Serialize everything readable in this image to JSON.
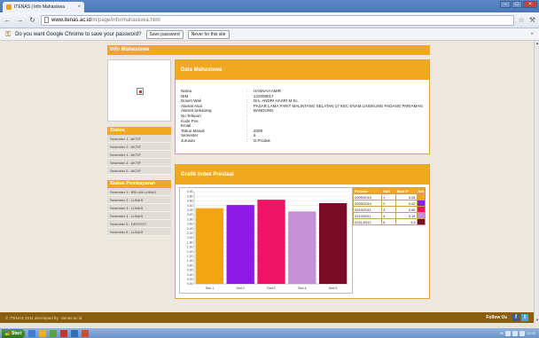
{
  "browser": {
    "tab_title": "ITENAS | Info Mahasiswa",
    "url_host": "www.itenas.ac.id",
    "url_path": "/m/page/informahasiswa.html",
    "infobar": {
      "message": "Do you want Google Chrome to save your password?",
      "save_label": "Save password",
      "never_label": "Never for this site"
    }
  },
  "page": {
    "title": "Info Mahasiswa",
    "status": {
      "heading": "Status",
      "items": [
        "Semester 1 : AKTIF",
        "Semester 2 : AKTIF",
        "Semester 3 : AKTIF",
        "Semester 4 : AKTIF",
        "Semester 5 : AKTIF"
      ]
    },
    "payment": {
      "heading": "Status Pembayaran",
      "items": [
        "Semester 1 : BELUM LUNAS",
        "Semester 2 : LUNAS",
        "Semester 3 : LUNAS",
        "Semester 4 : LUNAS",
        "Semester 5 : DEPOSIT",
        "Semester 6 : LUNAS"
      ]
    },
    "data_panel": {
      "heading": "Data Mahasiswa",
      "rows": [
        {
          "label": "Nama",
          "value": "HASNAH AMIR"
        },
        {
          "label": "NIM",
          "value": "122009017"
        },
        {
          "label": "Dosen Wali",
          "value": "Drs. ANDRI HASRI M.Sc."
        },
        {
          "label": "Alamat Asal",
          "value": "PASAR LAMA PARIT MALINTANG SELATAN 17 KEC ENAM LINGKUNG PADANG PARIAMAN 25584"
        },
        {
          "label": "Alamat Sekarang",
          "value": "BANDUNG"
        },
        {
          "label": "No.Telepon",
          "value": ""
        },
        {
          "label": "Kode Pos.",
          "value": ""
        },
        {
          "label": "Email",
          "value": ""
        },
        {
          "label": "Tahun Masuk",
          "value": "2009"
        },
        {
          "label": "Semester",
          "value": "6"
        },
        {
          "label": "Jurusan",
          "value": "D.Produk"
        }
      ]
    },
    "chart_panel": {
      "heading": "Grafik Indek Prestasi",
      "legend_headers": [
        "Periode",
        "Smt",
        "Nilai IP",
        "Ket"
      ]
    },
    "footer": {
      "copyright": "© ITENAS 2011 developed by : itenas.ac.id",
      "follow": "Follow Us"
    }
  },
  "taskbar": {
    "start_label": "Start",
    "lang": "IN",
    "clock": "12:40"
  },
  "colors": {
    "accent": "#f0a820",
    "footer": "#8a5e10"
  },
  "chart_data": {
    "type": "bar",
    "title": "",
    "categories": [
      "Smt 1",
      "Smt 2",
      "Smt 3",
      "Smt 4",
      "Smt 5"
    ],
    "values": [
      3.28,
      3.42,
      3.65,
      3.14,
      3.5
    ],
    "periods": [
      "2009/2010",
      "2009/2010",
      "2010/2011",
      "2010/2011",
      "2011/2012"
    ],
    "semesters": [
      "1",
      "2",
      "3",
      "4",
      "5"
    ],
    "colors": [
      "#f2a50c",
      "#8e1ae6",
      "#ef1466",
      "#c690d8",
      "#7a0c28"
    ],
    "ylim": [
      0,
      4
    ],
    "yticks": [
      "0.00",
      "0.20",
      "0.40",
      "0.60",
      "0.80",
      "1.00",
      "1.20",
      "1.40",
      "1.60",
      "1.80",
      "2.00",
      "2.20",
      "2.40",
      "2.60",
      "2.80",
      "3.00",
      "3.20",
      "3.40",
      "3.60",
      "3.80",
      "4.00"
    ],
    "grid": true,
    "legend": "right"
  }
}
